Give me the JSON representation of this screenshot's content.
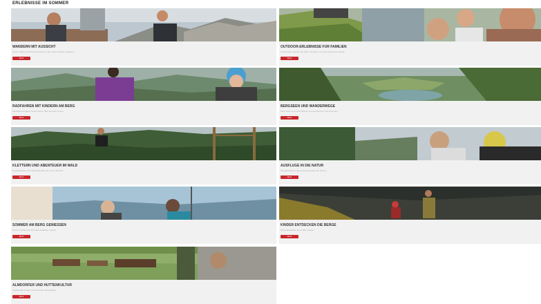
{
  "page": {
    "heading": "ERLEBNISSE IM SOMMER"
  },
  "cards": [
    {
      "title": "Wandern mit Aussicht",
      "desc": "Gipfel, Hütten und Panoramawege für die ganze Familie entdecken",
      "button": "Mehr",
      "scene": "mountain-hikers"
    },
    {
      "title": "Outdoor-Erlebnisse für Familien",
      "desc": "Gemeinsam draußen die Natur genießen und neue Abenteuer erleben",
      "button": "Mehr",
      "scene": "family-smiles"
    },
    {
      "title": "Radfahren mit Kindern am Berg",
      "desc": "Familienfreundliche Touren durch Täler und über Almen",
      "button": "Mehr",
      "scene": "bike-family"
    },
    {
      "title": "Bergseen und Wanderwege",
      "desc": "Klare Seen und grüne Wiesen zum Entspannen und Erkunden",
      "button": "Mehr",
      "scene": "alpine-lake"
    },
    {
      "title": "Klettern und Abenteuer im Wald",
      "desc": "Hochseilgärten und Naturspielplätze für Groß und Klein",
      "button": "Mehr",
      "scene": "forest-climb"
    },
    {
      "title": "Ausflüge in die Natur",
      "desc": "Tagesausflüge in die schönsten Ecken der Region",
      "button": "Mehr",
      "scene": "forest-friends"
    },
    {
      "title": "Sommer am Berg genießen",
      "desc": "Sonne, frische Luft und weite Ausblicke erleben",
      "button": "Mehr",
      "scene": "hikers-valley"
    },
    {
      "title": "Kinder entdecken die Berge",
      "desc": "Kleine Entdecker auf großen Wegen",
      "button": "Mehr",
      "scene": "kids-hike"
    },
    {
      "title": "Almdörfer und Hüttenkultur",
      "desc": "Traditionelle Hütten und regionale Spezialitäten",
      "button": "Mehr",
      "scene": "village"
    }
  ]
}
